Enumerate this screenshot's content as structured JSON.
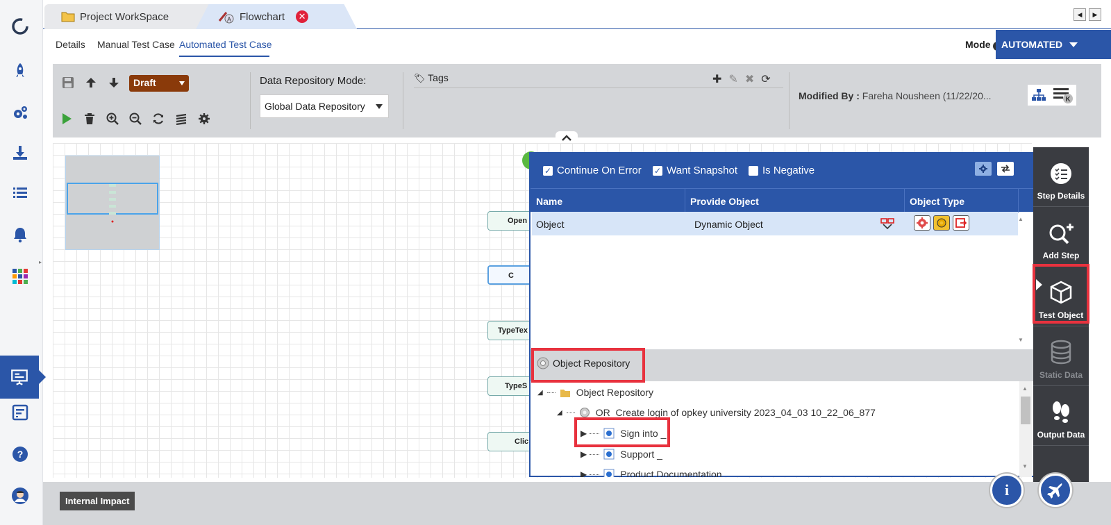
{
  "tabs": {
    "workspace_label": "Project WorkSpace",
    "flowchart_label": "Flowchart",
    "close_glyph": "✕"
  },
  "subtabs": {
    "details": "Details",
    "manual": "Manual Test Case",
    "automated": "Automated Test Case"
  },
  "mode": {
    "label": "Mode",
    "value": "AUTOMATED"
  },
  "toolbar": {
    "status_value": "Draft",
    "data_repo_label": "Data Repository Mode:",
    "data_repo_value": "Global Data Repository",
    "tags_label": "Tags",
    "modified_label": "Modified By :",
    "modified_value": "Fareha Nousheen (11/22/20..."
  },
  "canvas": {
    "nodes": [
      "Open",
      "C",
      "TypeTex",
      "TypeS",
      "Clic"
    ]
  },
  "panel": {
    "continue_on_error": "Continue On Error",
    "want_snapshot": "Want Snapshot",
    "is_negative": "Is Negative",
    "col_name": "Name",
    "col_provide": "Provide Object",
    "col_type": "Object Type",
    "row_name": "Object",
    "row_provide": "Dynamic Object",
    "or_button": "Object Repository",
    "tree": {
      "root": "Object Repository",
      "child": "OR_Create login of opkey university 2023_04_03 10_22_06_877",
      "leaf1": "Sign into _",
      "leaf2": "Support _",
      "leaf3": "Product Documentation"
    }
  },
  "rightrail": {
    "step_details": "Step Details",
    "add_step": "Add Step",
    "test_object": "Test Object",
    "static_data": "Static Data",
    "output_data": "Output Data"
  },
  "bottom": {
    "impact": "Internal Impact",
    "info_glyph": "i"
  },
  "colors": {
    "brand": "#2b56a8",
    "highlight": "#e8323e",
    "draft": "#8a3a0a"
  }
}
